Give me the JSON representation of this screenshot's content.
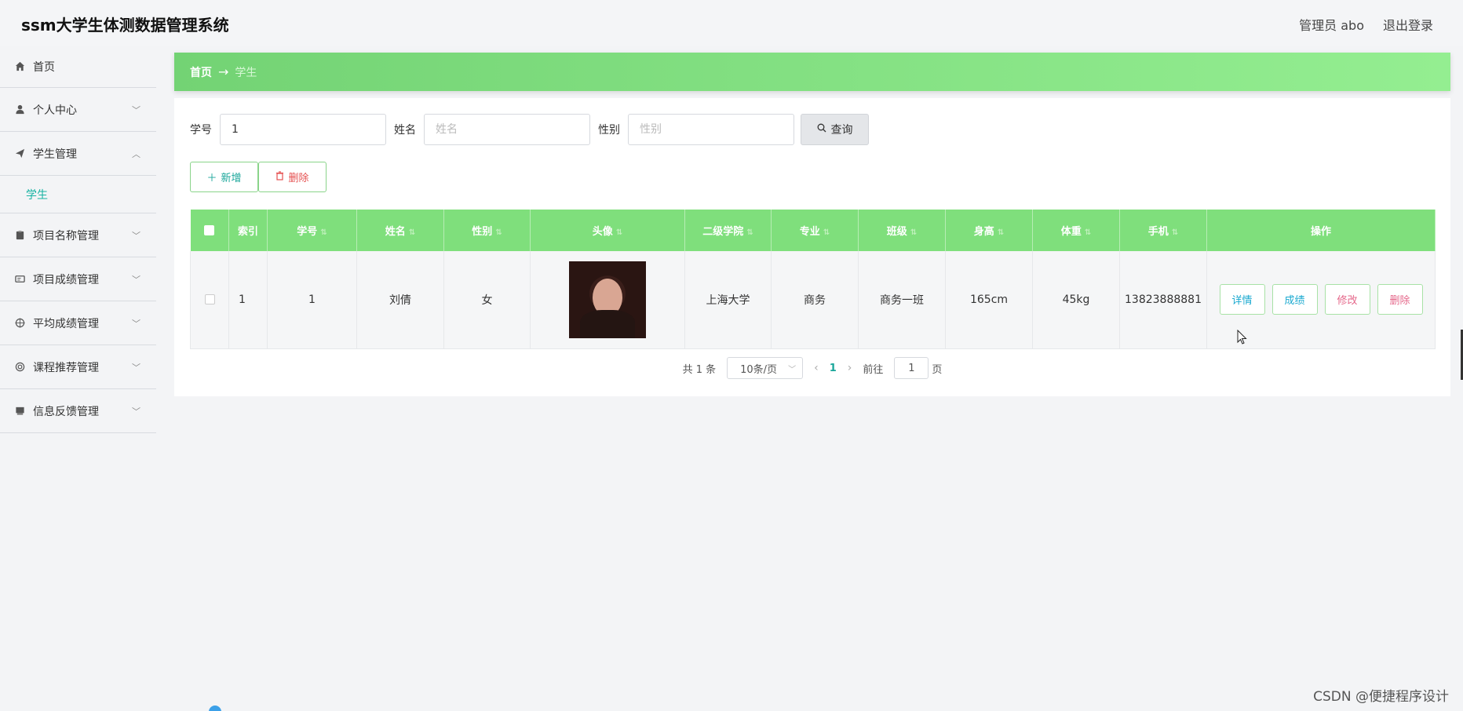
{
  "app": {
    "title": "ssm大学生体测数据管理系统"
  },
  "header": {
    "user": "管理员 abo",
    "logout": "退出登录"
  },
  "sidebar": {
    "items": [
      {
        "label": "首页",
        "icon": "home-icon"
      },
      {
        "label": "个人中心",
        "icon": "user-icon"
      },
      {
        "label": "学生管理",
        "icon": "send-icon",
        "expanded": true,
        "children": [
          {
            "label": "学生"
          }
        ]
      },
      {
        "label": "项目名称管理",
        "icon": "clipboard-icon"
      },
      {
        "label": "项目成绩管理",
        "icon": "id-card-icon"
      },
      {
        "label": "平均成绩管理",
        "icon": "target-icon"
      },
      {
        "label": "课程推荐管理",
        "icon": "circle-icon"
      },
      {
        "label": "信息反馈管理",
        "icon": "folder-icon"
      }
    ]
  },
  "breadcrumb": {
    "home": "首页",
    "current": "学生"
  },
  "filters": {
    "student_id": {
      "label": "学号",
      "value": "1",
      "placeholder": ""
    },
    "name": {
      "label": "姓名",
      "value": "",
      "placeholder": "姓名"
    },
    "gender": {
      "label": "性别",
      "value": "",
      "placeholder": "性别"
    },
    "query_label": "查询"
  },
  "actions": {
    "add_label": "新增",
    "delete_label": "删除"
  },
  "table": {
    "columns": [
      "索引",
      "学号",
      "姓名",
      "性别",
      "头像",
      "二级学院",
      "专业",
      "班级",
      "身高",
      "体重",
      "手机",
      "操作"
    ],
    "rows": [
      {
        "index": "1",
        "student_id": "1",
        "name": "刘倩",
        "gender": "女",
        "college": "上海大学",
        "major": "商务",
        "class": "商务一班",
        "height": "165cm",
        "weight": "45kg",
        "phone": "13823888881"
      }
    ],
    "ops": {
      "detail": "详情",
      "score": "成绩",
      "edit": "修改",
      "delete": "删除"
    }
  },
  "pager": {
    "total": "共 1 条",
    "page_size": "10条/页",
    "current": "1",
    "goto_prefix": "前往",
    "goto_value": "1",
    "goto_suffix": "页"
  },
  "watermark": "CSDN @便捷程序设计",
  "colors": {
    "accent": "#7fdf7c",
    "teal": "#19a69a",
    "danger": "#e55050"
  }
}
